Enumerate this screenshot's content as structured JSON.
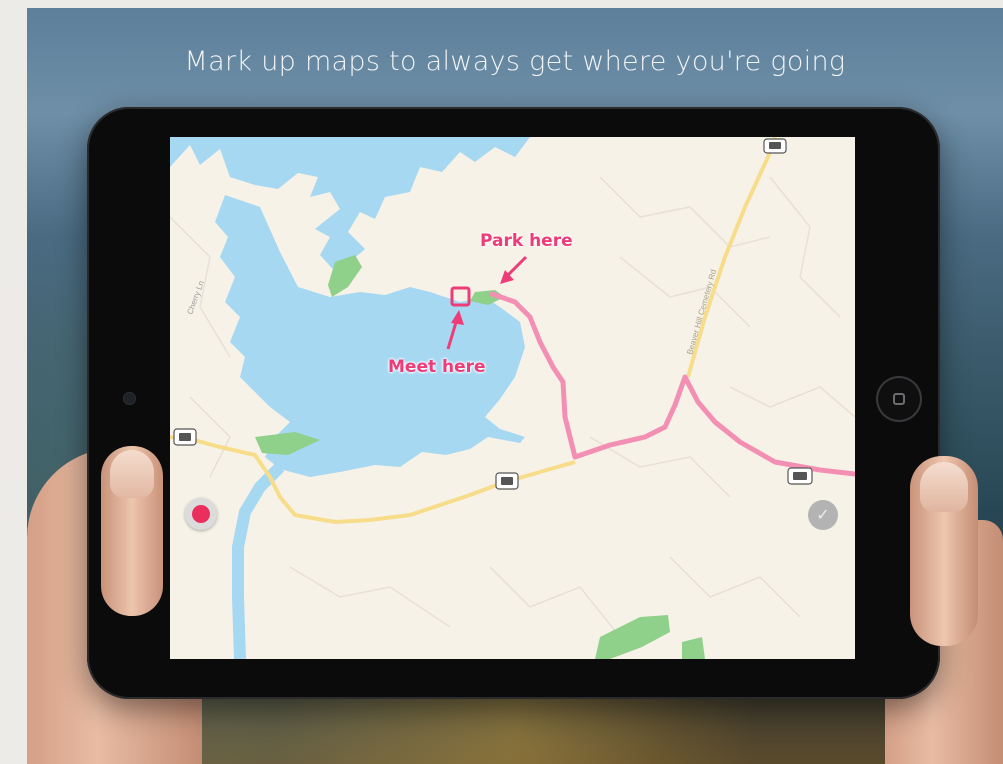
{
  "headline": "Mark up maps to always get where you're going",
  "annotations": {
    "park_label": "Park here",
    "meet_label": "Meet here"
  },
  "map": {
    "road_labels": [
      "Cherry Ln",
      "Beaver Hill Cemetery Rd"
    ],
    "route_color": "#f48fb4",
    "annotation_color": "#ee3c78",
    "water_color": "#a6d8f2",
    "road_color": "#f7dc8a",
    "park_color": "#8fd08a"
  },
  "controls": {
    "record_icon": "record-dot-icon",
    "done_icon": "checkmark-icon",
    "done_symbol": "✓"
  }
}
